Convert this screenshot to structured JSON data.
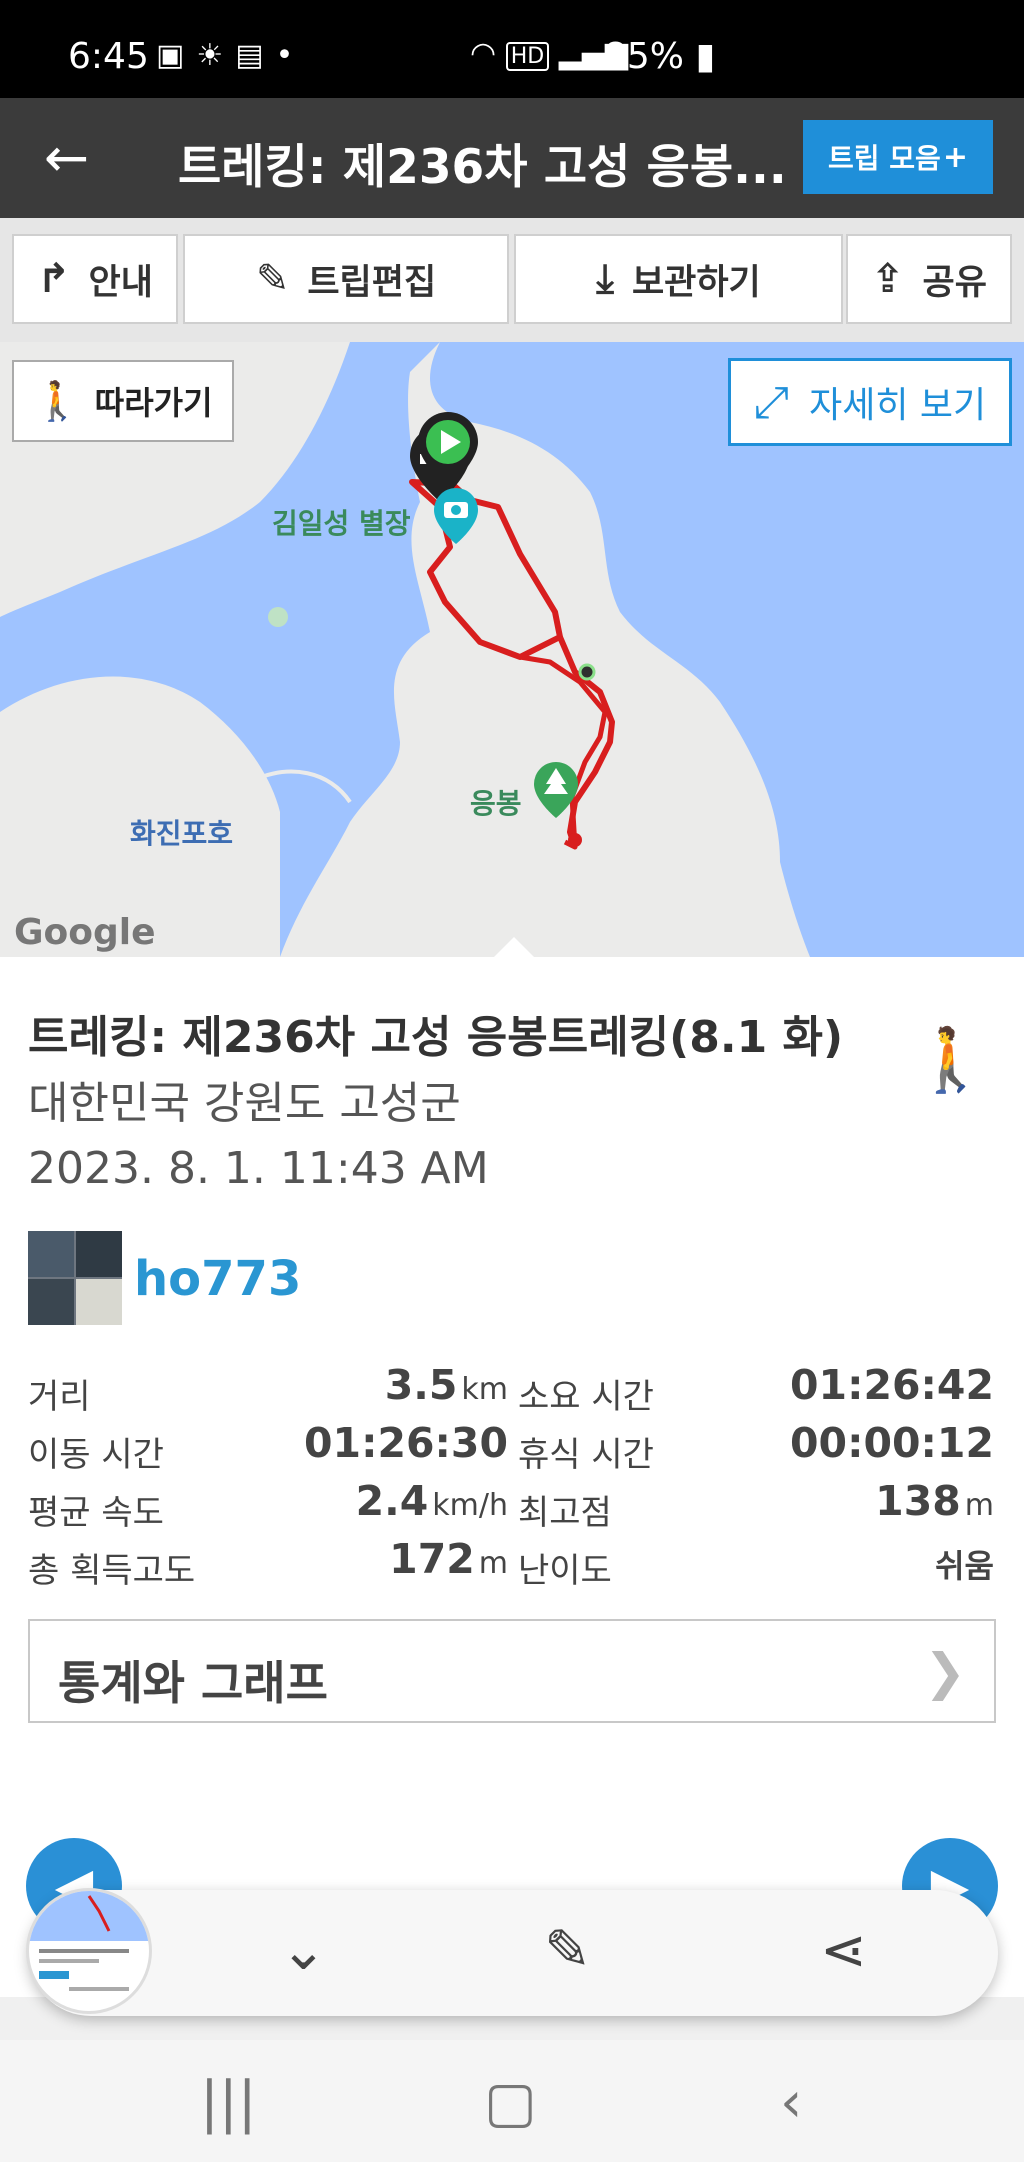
{
  "status": {
    "time": "6:45",
    "battery": "85%",
    "icons_left": [
      "image-icon",
      "sun-icon",
      "calendar-icon",
      "dot-icon"
    ],
    "icons_right": [
      "wifi-icon",
      "hd-icon",
      "signal-icon",
      "battery-icon"
    ]
  },
  "header": {
    "back_glyph": "←",
    "title": "트레킹: 제236차 고성 응봉...",
    "trip_button": "트립 모음",
    "trip_plus": "+"
  },
  "actions": {
    "guide": "안내",
    "edit": "트립편집",
    "save": "보관하기",
    "share": "공유"
  },
  "map": {
    "follow": "따라가기",
    "detail": "자세히 보기",
    "label_villa": "김일성 별장",
    "label_peak": "응봉",
    "label_lake": "화진포호",
    "attribution": "Google"
  },
  "trip": {
    "title": "트레킹: 제236차 고성 응봉트레킹(8.1 화)",
    "location": "대한민국 강원도 고성군",
    "datetime": "2023. 8. 1. 11:43 AM",
    "user": "ho773"
  },
  "stats": {
    "distance_label": "거리",
    "distance_value": "3.5",
    "distance_unit": "km",
    "duration_label": "소요 시간",
    "duration_value": "01:26:42",
    "moving_label": "이동 시간",
    "moving_value": "01:26:30",
    "rest_label": "휴식 시간",
    "rest_value": "00:00:12",
    "speed_label": "평균 속도",
    "speed_value": "2.4",
    "speed_unit": "km/h",
    "max_label": "최고점",
    "max_value": "138",
    "max_unit": "m",
    "gain_label": "총 획득고도",
    "gain_value": "172",
    "gain_unit": "m",
    "difficulty_label": "난이도",
    "difficulty_value": "쉬움"
  },
  "graph_button": "통계와 그래프",
  "graph_chevron": "❯",
  "colors": {
    "accent": "#1f8fd9",
    "track": "#d81e1e",
    "topbar": "#3b3b3b",
    "water": "#9fc3ff"
  }
}
